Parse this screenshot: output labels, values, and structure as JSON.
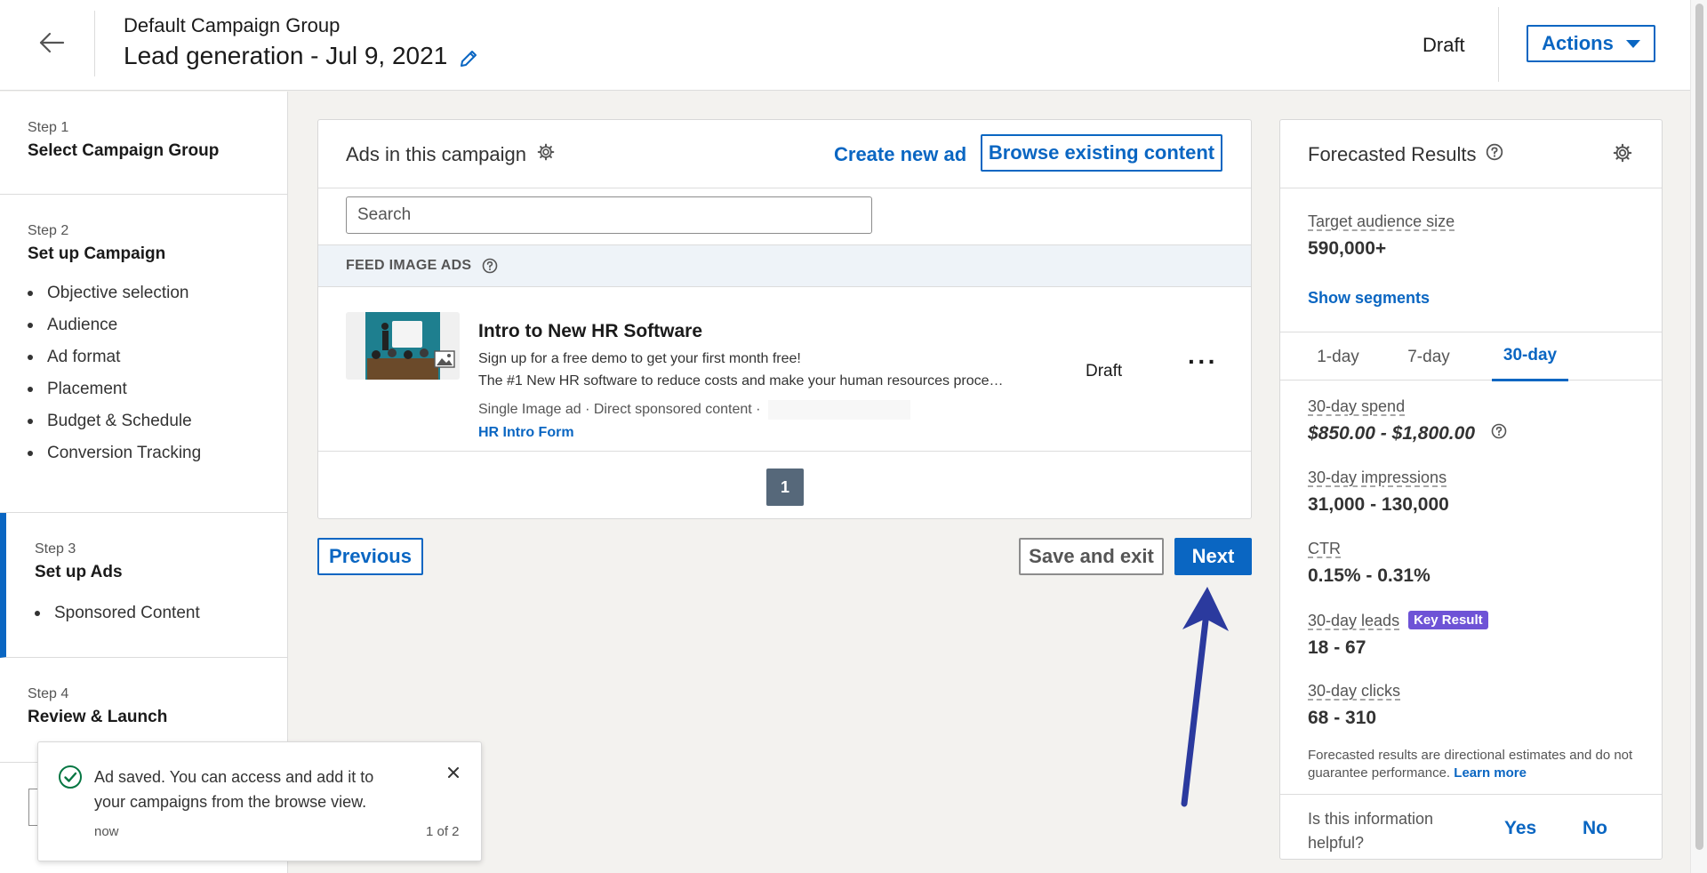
{
  "header": {
    "campaign_group": "Default Campaign Group",
    "campaign_name": "Lead generation - Jul 9, 2021",
    "status": "Draft",
    "actions_label": "Actions"
  },
  "sidebar": {
    "steps": [
      {
        "num": "Step 1",
        "title": "Select Campaign Group",
        "items": []
      },
      {
        "num": "Step 2",
        "title": "Set up Campaign",
        "items": [
          "Objective selection",
          "Audience",
          "Ad format",
          "Placement",
          "Budget & Schedule",
          "Conversion Tracking"
        ]
      },
      {
        "num": "Step 3",
        "title": "Set up Ads",
        "items": [
          "Sponsored Content"
        ]
      },
      {
        "num": "Step 4",
        "title": "Review & Launch",
        "items": []
      }
    ]
  },
  "ads": {
    "title": "Ads in this campaign",
    "create_label": "Create new ad",
    "browse_label": "Browse existing content",
    "search_placeholder": "Search",
    "section_label": "FEED IMAGE ADS",
    "ad": {
      "title": "Intro to New HR Software",
      "line1": "Sign up for a free demo to get your first month free!",
      "line2": "The #1 New HR software to reduce costs and make your human resources proce…",
      "meta": "Single Image ad · Direct sponsored content ·",
      "form": "HR Intro Form",
      "status": "Draft",
      "more": "···"
    },
    "page": "1"
  },
  "nav": {
    "previous": "Previous",
    "save_exit": "Save and exit",
    "next": "Next"
  },
  "forecast": {
    "title": "Forecasted Results",
    "audience_label": "Target audience size",
    "audience_value": "590,000+",
    "show_segments": "Show segments",
    "tabs": [
      "1-day",
      "7-day",
      "30-day"
    ],
    "active_tab": "30-day",
    "spend_label": "30-day spend",
    "spend_value": "$850.00 - $1,800.00",
    "impressions_label": "30-day impressions",
    "impressions_value": "31,000 - 130,000",
    "ctr_label": "CTR",
    "ctr_value": "0.15% - 0.31%",
    "leads_label": "30-day leads",
    "leads_badge": "Key Result",
    "leads_value": "18 - 67",
    "clicks_label": "30-day clicks",
    "clicks_value": "68 - 310",
    "disclaimer": "Forecasted results are directional estimates and do not guarantee performance.",
    "learn_more": "Learn more",
    "helpful_q": "Is this information helpful?",
    "yes": "Yes",
    "no": "No"
  },
  "toast": {
    "message": "Ad saved. You can access and add it to your campaigns from the browse view.",
    "time": "now",
    "count": "1 of 2"
  },
  "colors": {
    "accent": "#0a66c2",
    "badge": "#6e53d6",
    "success": "#057642",
    "arrow": "#2b3a9e"
  }
}
